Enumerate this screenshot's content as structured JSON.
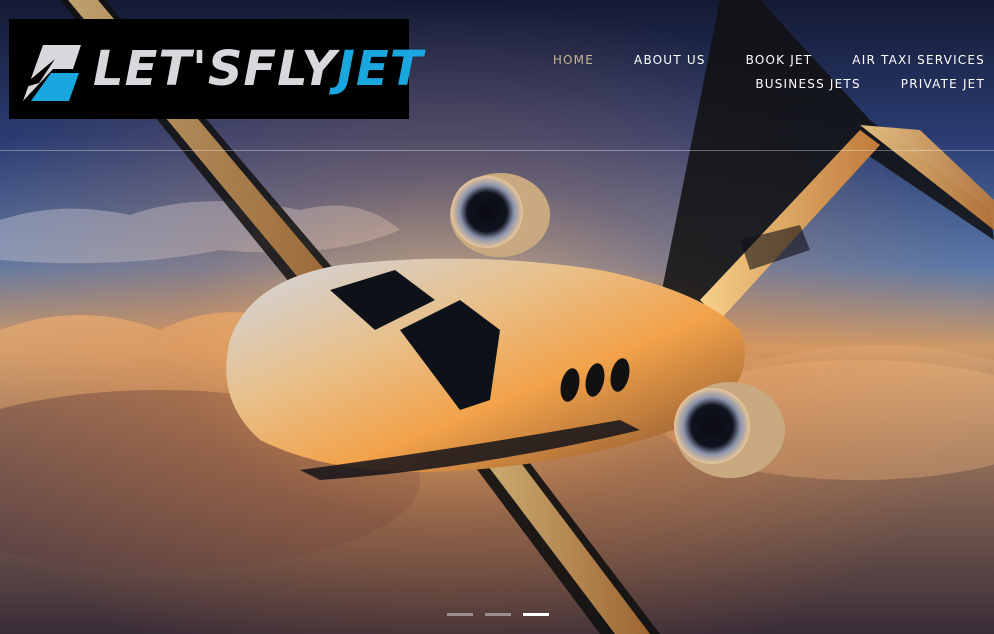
{
  "logo": {
    "part1": "LET'SFLY",
    "part2": "JET"
  },
  "nav": {
    "row1": [
      {
        "label": "HOME",
        "active": true
      },
      {
        "label": "ABOUT US",
        "active": false
      },
      {
        "label": "BOOK JET",
        "active": false
      },
      {
        "label": "AIR TAXI SERVICES",
        "active": false
      }
    ],
    "row2": [
      {
        "label": "BUSINESS JETS",
        "active": false
      },
      {
        "label": "PRIVATE JET",
        "active": false
      }
    ]
  },
  "slider": {
    "slides": 3,
    "active_index": 2
  },
  "colors": {
    "brand_blue": "#1aa7df",
    "nav_active": "#c9b38c",
    "nav_text": "#ffffff"
  }
}
